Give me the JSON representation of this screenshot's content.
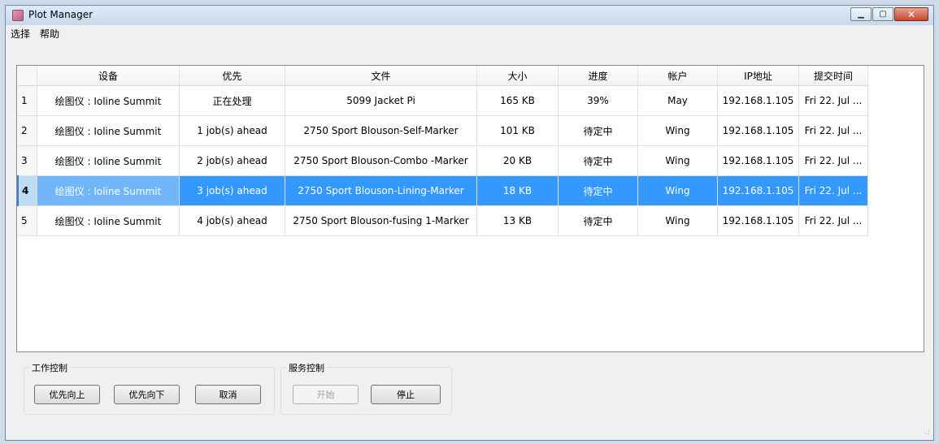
{
  "window": {
    "title": "Plot Manager"
  },
  "menu": [
    "选择",
    "帮助"
  ],
  "table": {
    "headers": [
      "设备",
      "优先",
      "文件",
      "大小",
      "进度",
      "帐户",
      "IP地址",
      "提交时间"
    ],
    "rows": [
      {
        "num": "1",
        "device": "绘图仪 : Ioline Summit",
        "priority": "正在处理",
        "file": "5099 Jacket Pi",
        "size": "165 KB",
        "progress": "39%",
        "account": "May",
        "ip": "192.168.1.105",
        "time": "Fri 22. Jul ..."
      },
      {
        "num": "2",
        "device": "绘图仪 : Ioline Summit",
        "priority": "1 job(s) ahead",
        "file": "2750 Sport Blouson-Self-Marker",
        "size": "101 KB",
        "progress": "待定中",
        "account": "Wing",
        "ip": "192.168.1.105",
        "time": "Fri 22. Jul ..."
      },
      {
        "num": "3",
        "device": "绘图仪 : Ioline Summit",
        "priority": "2 job(s) ahead",
        "file": "2750 Sport Blouson-Combo -Marker",
        "size": "20 KB",
        "progress": "待定中",
        "account": "Wing",
        "ip": "192.168.1.105",
        "time": "Fri 22. Jul ..."
      },
      {
        "num": "4",
        "device": "绘图仪 : Ioline Summit",
        "priority": "3 job(s) ahead",
        "file": "2750 Sport Blouson-Lining-Marker",
        "size": "18 KB",
        "progress": "待定中",
        "account": "Wing",
        "ip": "192.168.1.105",
        "time": "Fri 22. Jul ..."
      },
      {
        "num": "5",
        "device": "绘图仪 : Ioline Summit",
        "priority": "4 job(s) ahead",
        "file": "2750 Sport Blouson-fusing 1-Marker",
        "size": "13 KB",
        "progress": "待定中",
        "account": "Wing",
        "ip": "192.168.1.105",
        "time": "Fri 22. Jul ..."
      }
    ],
    "selected_row": 4
  },
  "job_control": {
    "title": "工作控制",
    "up": "优先向上",
    "down": "优先向下",
    "cancel": "取消"
  },
  "service_control": {
    "title": "服务控制",
    "start": "开始",
    "stop": "停止"
  }
}
